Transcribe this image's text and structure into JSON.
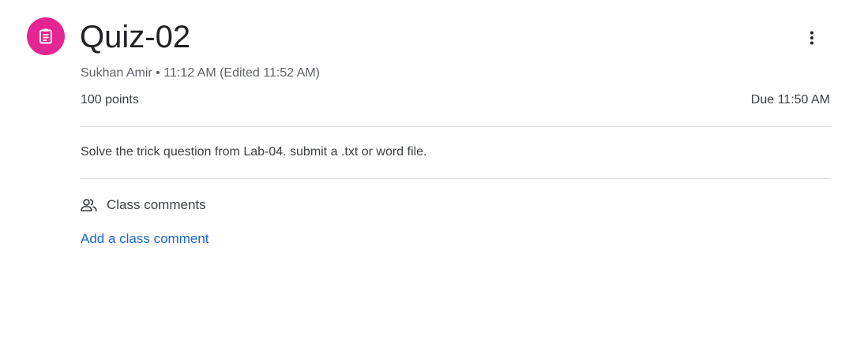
{
  "assignment": {
    "icon": "assignment-icon",
    "accent_color": "#e52592",
    "title": "Quiz-02",
    "author": "Sukhan Amir",
    "separator": "•",
    "posted_time": "11:12 AM (Edited 11:52 AM)",
    "points": "100 points",
    "due": "Due 11:50 AM",
    "description": "Solve the trick question from Lab-04. submit a .txt or word file."
  },
  "menu": {
    "icon": "more-vert-icon"
  },
  "comments": {
    "icon": "people-icon",
    "header": "Class comments",
    "add_link": "Add a class comment",
    "link_color": "#1967d2"
  }
}
